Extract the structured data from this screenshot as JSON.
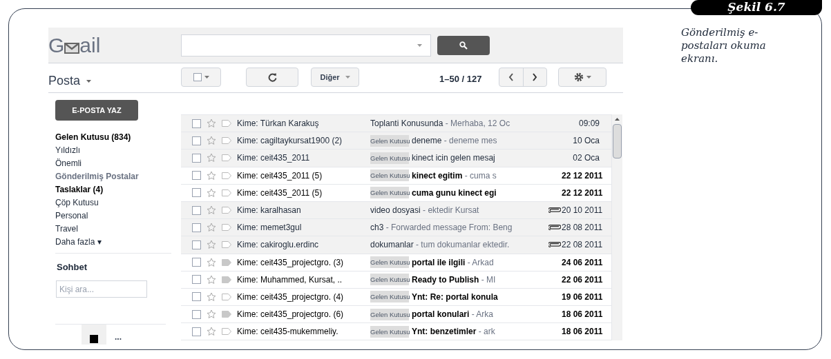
{
  "figure": {
    "badge": "Şekil 6.7",
    "caption": "Gönderilmiş e-postaları okuma ekranı."
  },
  "gmail": {
    "logo": {
      "before": "G",
      "after": "ail"
    },
    "toolbar": {
      "section": "Posta",
      "more": "Diğer",
      "pager": "1–50 / 127"
    },
    "compose": "E-POSTA YAZ",
    "folders": [
      {
        "label": "Gelen Kutusu (834)",
        "bold": true,
        "selected": false
      },
      {
        "label": "Yıldızlı",
        "bold": false,
        "selected": false
      },
      {
        "label": "Önemli",
        "bold": false,
        "selected": false
      },
      {
        "label": "Gönderilmiş Postalar",
        "bold": true,
        "selected": true
      },
      {
        "label": "Taslaklar (4)",
        "bold": true,
        "selected": false
      },
      {
        "label": "Çöp Kutusu",
        "bold": false,
        "selected": false
      },
      {
        "label": "Personal",
        "bold": false,
        "selected": false
      },
      {
        "label": "Travel",
        "bold": false,
        "selected": false
      },
      {
        "label": "Daha fazla ▾",
        "bold": false,
        "selected": false
      }
    ],
    "chat": {
      "title": "Sohbet",
      "placeholder": "Kişi ara...",
      "more": "..."
    },
    "messages": [
      {
        "sender": "Kime: Türkan Karakuş",
        "subject": "Toplanti Konusunda",
        "snippet": "- Merhaba, 12 Oc",
        "date": "09:09",
        "unread": false,
        "important": false,
        "attachment": false
      },
      {
        "sender": "Kime: cagiltaykursat1900 (2)",
        "tag": "Gelen Kutusu",
        "subject": "deneme",
        "snippet": "- deneme mes",
        "date": "10 Oca",
        "unread": false,
        "important": false,
        "attachment": false
      },
      {
        "sender": "Kime: ceit435_2011",
        "tag": "Gelen Kutusu",
        "subject": "kinect icin gelen mesaj",
        "date": "02 Oca",
        "unread": false,
        "important": false,
        "attachment": false
      },
      {
        "sender": "Kime: ceit435_2011 (5)",
        "tag": "Gelen Kutusu",
        "subject": "kinect egitim",
        "snippet": "- cuma s",
        "date": "22 12 2011",
        "unread": true,
        "important": false,
        "attachment": false
      },
      {
        "sender": "Kime: ceit435_2011 (5)",
        "tag": "Gelen Kutusu",
        "subject": "cuma gunu kinect egi",
        "date": "22 12 2011",
        "unread": true,
        "important": false,
        "attachment": false
      },
      {
        "sender": "Kime: karalhasan",
        "subject": "video dosyasi",
        "snippet": "- ektedir Kursat",
        "date": "20 10 2011",
        "unread": false,
        "important": false,
        "attachment": true
      },
      {
        "sender": "Kime: memet3gul",
        "subject": "ch3",
        "snippet": "- Forwarded message From: Beng",
        "date": "28 08 2011",
        "unread": false,
        "important": false,
        "attachment": true
      },
      {
        "sender": "Kime: cakiroglu.erdinc",
        "subject": "dokumanlar",
        "snippet": "- tum dokumanlar ektedir.",
        "date": "22 08 2011",
        "unread": false,
        "important": false,
        "attachment": true
      },
      {
        "sender": "Kime: ceit435_projectgro. (3)",
        "tag": "Gelen Kutusu",
        "subject": "portal ile ilgili",
        "snippet": "- Arkad",
        "date": "24 06 2011",
        "unread": true,
        "important": true,
        "attachment": false
      },
      {
        "sender": "Kime: Muhammed, Kursat, ..",
        "tag": "Gelen Kutusu",
        "subject": "Ready to Publish",
        "snippet": "- MI",
        "date": "22 06 2011",
        "unread": true,
        "important": true,
        "attachment": false
      },
      {
        "sender": "Kime: ceit435_projectgro. (4)",
        "tag": "Gelen Kutusu",
        "subject": "Ynt: Re: portal konula",
        "date": "19 06 2011",
        "unread": true,
        "important": false,
        "attachment": false
      },
      {
        "sender": "Kime: ceit435_projectgro. (6)",
        "tag": "Gelen Kutusu",
        "subject": "portal konulari",
        "snippet": "- Arka",
        "date": "18 06 2011",
        "unread": true,
        "important": true,
        "attachment": false
      },
      {
        "sender": "Kime: ceit435-mukemmeliy.",
        "tag": "Gelen Kutusu",
        "subject": "Ynt: benzetimler",
        "snippet": "- ark",
        "date": "18 06 2011",
        "unread": true,
        "important": false,
        "attachment": false
      }
    ]
  }
}
